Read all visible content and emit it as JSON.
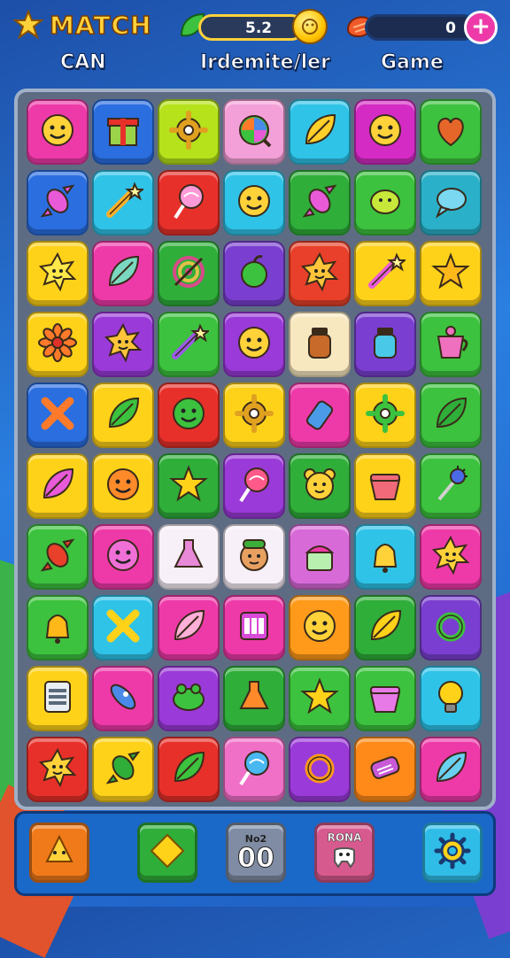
{
  "header": {
    "logo_text": "MATCH",
    "left_label": "CAN",
    "mid_label": "Irdemite/ler",
    "right_label": "Game",
    "mid_bar_value": "5.2",
    "right_bar_value": "0",
    "plus_label": "+"
  },
  "board": {
    "rows": [
      [
        {
          "bg": "#ee3aa8",
          "icon": "smiley-icon",
          "c": "#ffd23a"
        },
        {
          "bg": "#2a6ee0",
          "icon": "gift-box-icon",
          "c": "#9ad24a"
        },
        {
          "bg": "#b5e21a",
          "icon": "gear-icon",
          "c": "#e0a020"
        },
        {
          "bg": "#f4a0d8",
          "icon": "rainbow-orb-icon",
          "c": "#ff7a2a"
        },
        {
          "bg": "#2fc3e8",
          "icon": "leaf-icon",
          "c": "#ffcf2a"
        },
        {
          "bg": "#d42bc4",
          "icon": "smiley-icon",
          "c": "#ffd23a"
        },
        {
          "bg": "#3cc23e",
          "icon": "heart-icon",
          "c": "#e6662a"
        }
      ],
      [
        {
          "bg": "#2a6ee0",
          "icon": "candy-icon",
          "c": "#e85ad8"
        },
        {
          "bg": "#2fc3e8",
          "icon": "wand-icon",
          "c": "#ffb02a"
        },
        {
          "bg": "#e8302a",
          "icon": "lollipop-icon",
          "c": "#ff9ad8"
        },
        {
          "bg": "#2fc3e8",
          "icon": "smiley-icon",
          "c": "#ffd23a"
        },
        {
          "bg": "#2fae3a",
          "icon": "candy-icon",
          "c": "#e85ad8"
        },
        {
          "bg": "#3cc23e",
          "icon": "blob-icon",
          "c": "#c7e83a"
        },
        {
          "bg": "#2ab0c8",
          "icon": "speech-bubble-icon",
          "c": "#7ad8f0"
        }
      ],
      [
        {
          "bg": "#ffd21a",
          "icon": "sun-icon",
          "c": "#ffe84a"
        },
        {
          "bg": "#ee3aa8",
          "icon": "leaf-icon",
          "c": "#7ad8c0"
        },
        {
          "bg": "#2fae3a",
          "icon": "target-icon",
          "c": "#d84a8a"
        },
        {
          "bg": "#7a3fd0",
          "icon": "apple-icon",
          "c": "#3cc23e"
        },
        {
          "bg": "#e8402a",
          "icon": "sun-icon",
          "c": "#ffc43a"
        },
        {
          "bg": "#ffd21a",
          "icon": "wand-icon",
          "c": "#e85ad8"
        },
        {
          "bg": "#ffd21a",
          "icon": "star-icon",
          "c": "#ffb81a"
        }
      ],
      [
        {
          "bg": "#ffd21a",
          "icon": "flower-icon",
          "c": "#ff7a2a"
        },
        {
          "bg": "#9a3ad8",
          "icon": "sun-icon",
          "c": "#ffc43a"
        },
        {
          "bg": "#3cc23e",
          "icon": "wand-icon",
          "c": "#9a5ae8"
        },
        {
          "bg": "#9a3ad8",
          "icon": "smiley-icon",
          "c": "#ffd23a"
        },
        {
          "bg": "#f8e8c0",
          "icon": "jar-icon",
          "c": "#c86a2a"
        },
        {
          "bg": "#7a3fd0",
          "icon": "jar-icon",
          "c": "#4ac8e8"
        },
        {
          "bg": "#3cc23e",
          "icon": "cup-icon",
          "c": "#f070c0"
        }
      ],
      [
        {
          "bg": "#2a6ee0",
          "icon": "cross-icon",
          "c": "#ff7a2a"
        },
        {
          "bg": "#ffd21a",
          "icon": "leaf-icon",
          "c": "#3cc23e"
        },
        {
          "bg": "#e8302a",
          "icon": "smiley-icon",
          "c": "#3cc23e"
        },
        {
          "bg": "#ffd21a",
          "icon": "gear-icon",
          "c": "#e0a020"
        },
        {
          "bg": "#ee3aa8",
          "icon": "bottle-icon",
          "c": "#4a9ae8"
        },
        {
          "bg": "#ffd21a",
          "icon": "gear-icon",
          "c": "#3cc23e"
        },
        {
          "bg": "#3cc23e",
          "icon": "leaf-icon",
          "c": "#2fae3a"
        }
      ],
      [
        {
          "bg": "#ffd21a",
          "icon": "leaf-icon",
          "c": "#e85ad8"
        },
        {
          "bg": "#ffd21a",
          "icon": "smiley-icon",
          "c": "#ff8a2a"
        },
        {
          "bg": "#2fae3a",
          "icon": "star-icon",
          "c": "#ffd21a"
        },
        {
          "bg": "#9a3ad8",
          "icon": "lollipop-icon",
          "c": "#ff5a8a"
        },
        {
          "bg": "#2fae3a",
          "icon": "bear-icon",
          "c": "#ffd23a"
        },
        {
          "bg": "#ffd21a",
          "icon": "pot-icon",
          "c": "#f06a7a"
        },
        {
          "bg": "#3cc23e",
          "icon": "mace-icon",
          "c": "#4a6ae8"
        }
      ],
      [
        {
          "bg": "#3cc23e",
          "icon": "candy-icon",
          "c": "#e8402a"
        },
        {
          "bg": "#ee3aa8",
          "icon": "smiley-icon",
          "c": "#f070d8"
        },
        {
          "bg": "#f8f0f8",
          "icon": "potion-icon",
          "c": "#e88ad8"
        },
        {
          "bg": "#f8f0f8",
          "icon": "face-icon",
          "c": "#e8a060"
        },
        {
          "bg": "#d86ad8",
          "icon": "cake-icon",
          "c": "#b8f0b0"
        },
        {
          "bg": "#2fc3e8",
          "icon": "bell-icon",
          "c": "#ffd23a"
        },
        {
          "bg": "#ee3aa8",
          "icon": "sun-icon",
          "c": "#ffd23a"
        }
      ],
      [
        {
          "bg": "#3cc23e",
          "icon": "bell-icon",
          "c": "#ffb81a"
        },
        {
          "bg": "#2fc3e8",
          "icon": "cross-icon",
          "c": "#ffd21a"
        },
        {
          "bg": "#ee3aa8",
          "icon": "leaf-icon",
          "c": "#ffb0d8"
        },
        {
          "bg": "#ee3aa8",
          "icon": "grid-icon",
          "c": "#d84ad8"
        },
        {
          "bg": "#ff9a1a",
          "icon": "smiley-icon",
          "c": "#ffd23a"
        },
        {
          "bg": "#2fae3a",
          "icon": "leaf-icon",
          "c": "#ffd21a"
        },
        {
          "bg": "#7a3fd0",
          "icon": "ring-icon",
          "c": "#3cc23e"
        }
      ],
      [
        {
          "bg": "#ffd21a",
          "icon": "tablet-icon",
          "c": "#5a6a7a"
        },
        {
          "bg": "#ee3aa8",
          "icon": "rocket-icon",
          "c": "#4a8ae8"
        },
        {
          "bg": "#9a3ad8",
          "icon": "frog-icon",
          "c": "#3cc23e"
        },
        {
          "bg": "#2fae3a",
          "icon": "potion-icon",
          "c": "#ff8a2a"
        },
        {
          "bg": "#3cc23e",
          "icon": "star-icon",
          "c": "#ffd21a"
        },
        {
          "bg": "#3cc23e",
          "icon": "pot-icon",
          "c": "#e87ae8"
        },
        {
          "bg": "#2fc3e8",
          "icon": "bulb-icon",
          "c": "#ffd21a"
        }
      ],
      [
        {
          "bg": "#e8302a",
          "icon": "sun-icon",
          "c": "#ffd23a"
        },
        {
          "bg": "#ffd21a",
          "icon": "candy-icon",
          "c": "#2fae3a"
        },
        {
          "bg": "#e8302a",
          "icon": "leaf-icon",
          "c": "#3cc23e"
        },
        {
          "bg": "#f070c8",
          "icon": "lollipop-icon",
          "c": "#4ab8f0"
        },
        {
          "bg": "#9a3ad8",
          "icon": "ring-icon",
          "c": "#ff9a1a"
        },
        {
          "bg": "#ff8a1a",
          "icon": "scroll-icon",
          "c": "#c85ad8"
        },
        {
          "bg": "#ee3aa8",
          "icon": "leaf-icon",
          "c": "#6ad0f0"
        }
      ]
    ]
  },
  "bottom_bar": {
    "btn3_label": "No2",
    "btn3_value": "00",
    "btn4_label": "RONA"
  }
}
